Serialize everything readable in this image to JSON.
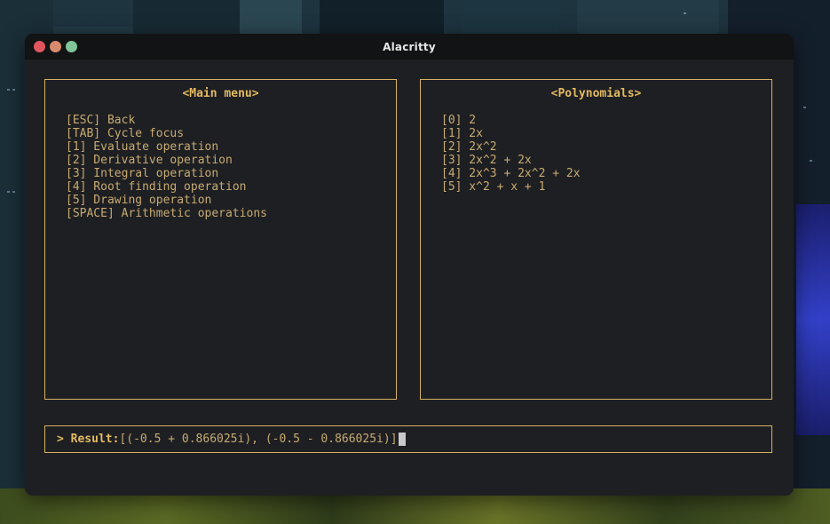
{
  "window": {
    "title": "Alacritty"
  },
  "main_menu": {
    "title": "<Main menu>",
    "items": [
      "[ESC] Back",
      "[TAB] Cycle focus",
      "[1] Evaluate operation",
      "[2] Derivative operation",
      "[3] Integral operation",
      "[4] Root finding operation",
      "[5] Drawing operation",
      "[SPACE] Arithmetic operations"
    ]
  },
  "polynomials": {
    "title": "<Polynomials>",
    "items": [
      "[0] 2",
      "[1] 2x",
      "[2] 2x^2",
      "[3] 2x^2 + 2x",
      "[4] 2x^3 + 2x^2 + 2x",
      "[5] x^2 + x + 1"
    ]
  },
  "result": {
    "prompt": "> ",
    "label": "Result:",
    "value": "[(-0.5 + 0.866025i), (-0.5 - 0.866025i)]"
  },
  "colors": {
    "accent": "#e4ba62",
    "text": "#c7ab72",
    "border": "#d7b262",
    "background": "#1e1f22"
  }
}
